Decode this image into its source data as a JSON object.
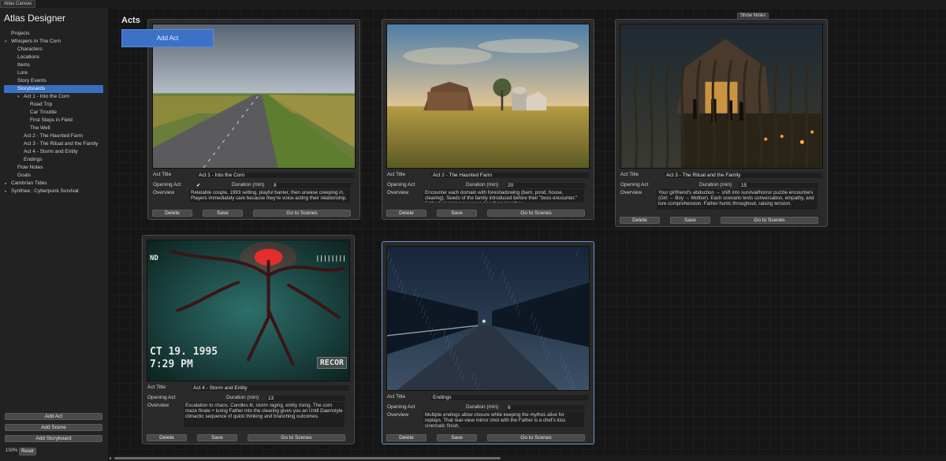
{
  "window": {
    "tab_title": "Atlas Canvas"
  },
  "app_title": "Atlas Designer",
  "tree": [
    {
      "label": "Projects",
      "indent": 0,
      "arrow": ""
    },
    {
      "label": "Whispers In The Corn",
      "indent": 0,
      "arrow": "▾"
    },
    {
      "label": "Characters",
      "indent": 1,
      "arrow": ""
    },
    {
      "label": "Locations",
      "indent": 1,
      "arrow": ""
    },
    {
      "label": "Items",
      "indent": 1,
      "arrow": ""
    },
    {
      "label": "Lore",
      "indent": 1,
      "arrow": ""
    },
    {
      "label": "Story Events",
      "indent": 1,
      "arrow": ""
    },
    {
      "label": "Storyboards",
      "indent": 1,
      "arrow": "",
      "selected": true
    },
    {
      "label": "Act 1 - Into the Corn",
      "indent": 2,
      "arrow": "▾"
    },
    {
      "label": "Road Trip",
      "indent": 3,
      "arrow": ""
    },
    {
      "label": "Car Trouble",
      "indent": 3,
      "arrow": ""
    },
    {
      "label": "First Steps in Field",
      "indent": 3,
      "arrow": ""
    },
    {
      "label": "The Well",
      "indent": 3,
      "arrow": ""
    },
    {
      "label": "Act 2 - The Haunted Farm",
      "indent": 2,
      "arrow": ""
    },
    {
      "label": "Act 3 - The Ritual and the Family",
      "indent": 2,
      "arrow": ""
    },
    {
      "label": "Act 4 - Storm and Entity",
      "indent": 2,
      "arrow": ""
    },
    {
      "label": "Endings",
      "indent": 2,
      "arrow": ""
    },
    {
      "label": "Flow Notes",
      "indent": 1,
      "arrow": ""
    },
    {
      "label": "Goals",
      "indent": 1,
      "arrow": ""
    },
    {
      "label": "Cambrian Tides",
      "indent": 0,
      "arrow": "▸"
    },
    {
      "label": "Synthea : Cyberpunk Survival",
      "indent": 0,
      "arrow": "▸"
    }
  ],
  "sidebar_buttons": {
    "add_act": "Add Act",
    "add_scene": "Add Scene",
    "add_storyboard": "Add Storyboard"
  },
  "zoom": {
    "level": "100%",
    "reset": "Reset"
  },
  "canvas": {
    "heading": "Acts",
    "add_act": "Add Act",
    "show_notes": "Show Notes"
  },
  "labels": {
    "act_title": "Act  Title",
    "opening_act": "Opening Act",
    "duration": "Duration (min)",
    "overview": "Overview",
    "delete": "Delete",
    "save": "Save",
    "go_to_scenes": "Go to Scenes"
  },
  "acts": [
    {
      "title": "Act 1 - Into the Corn",
      "opening": "✔",
      "duration": "8",
      "overview": "Relatable couple, 1993 setting, playful banter, then unease creeping in. Players immediately care because they're voice-acting their relationship.",
      "image": "road-through-cornfield"
    },
    {
      "title": "Act 2 - The Haunted Farm",
      "opening": "",
      "duration": "20",
      "overview": "Encounter each domain with foreshadowing (barn, pond, house, clearing). Seeds of the family introduced before their \"boss encounter.\" Father's looming presence ties them together.",
      "image": "farm-with-barn-and-silo"
    },
    {
      "title": "Act 3 - The Ritual and the Family",
      "opening": "",
      "duration": "15",
      "overview": " Your girlfriend's abduction → shift into survival/horror puzzle encounters (Girl → Boy → Mother). Each scenario tests conversation, empathy, and lore comprehension. Father hunts throughout, raising tension.",
      "image": "barn-ritual-at-night"
    },
    {
      "title": "Act 4 - Storm and Entity",
      "opening": "",
      "duration": "13",
      "overview": "Escalation to chaos. Candles lit, storm raging, entity rising. The corn maze finale + luring Father into the clearing gives you an Until Dawnstyle climactic sequence of quick thinking and branching outcomes.",
      "image": "vhs-entity",
      "vhs": {
        "left": "ND",
        "right": "||||||||",
        "date": "CT 19. 1995",
        "time": "7:29 PM",
        "rec": "RECOR"
      }
    },
    {
      "title": "Endings",
      "opening": "",
      "duration": "6",
      "overview": "Multiple endings allow closure while keeping the mythos alive for replays. That rear-view mirror shot with the Father is a chef's kiss cinematic finish.",
      "image": "rainy-road-at-night"
    }
  ]
}
